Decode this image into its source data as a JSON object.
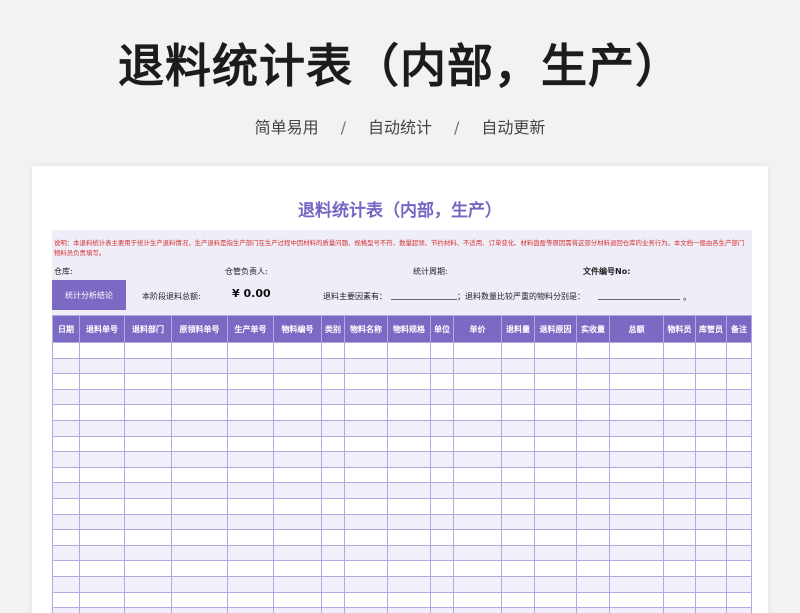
{
  "banner": {
    "title": "退料统计表（内部，生产）",
    "features": [
      "简单易用",
      "自动统计",
      "自动更新"
    ],
    "separator": "/"
  },
  "sheet": {
    "title": "退料统计表（内部，生产）",
    "note": "说明：本退料统计表主要用于统计生产退料情况，生产退料是指生产部门在生产过程中因材料的质量问题、规格型号不符、数量超领、节约材料、不适用、订单变化、材料盘盈等原因需将这部分材料退回仓库的业务行为。本文档一般由各生产部门物料员负责填写。",
    "meta": {
      "warehouse_label": "仓库:",
      "manager_label": "仓管负责人:",
      "period_label": "统计周期:",
      "doc_no_label": "文件编号No:"
    },
    "summary": {
      "tab_label": "统计分析结论",
      "total_label": "本阶段退料总额:",
      "total_value": "¥ 0.00",
      "reason_label": "退料主要因素有：",
      "severe_label": "；退料数量比较严重的物料分别是：",
      "end_mark": "。"
    },
    "table": {
      "columns": [
        "日期",
        "退料单号",
        "退料部门",
        "原领料单号",
        "生产单号",
        "物料编号",
        "类别",
        "物料名称",
        "物料规格",
        "单位",
        "单价",
        "退料量",
        "退料原因",
        "实收量",
        "总额",
        "物料员",
        "库管员",
        "备注"
      ],
      "row_count": 18
    }
  },
  "colors": {
    "accent": "#7c69c4",
    "title_purple": "#7566c3",
    "note_red": "#d43131",
    "band": "#efedf8"
  }
}
